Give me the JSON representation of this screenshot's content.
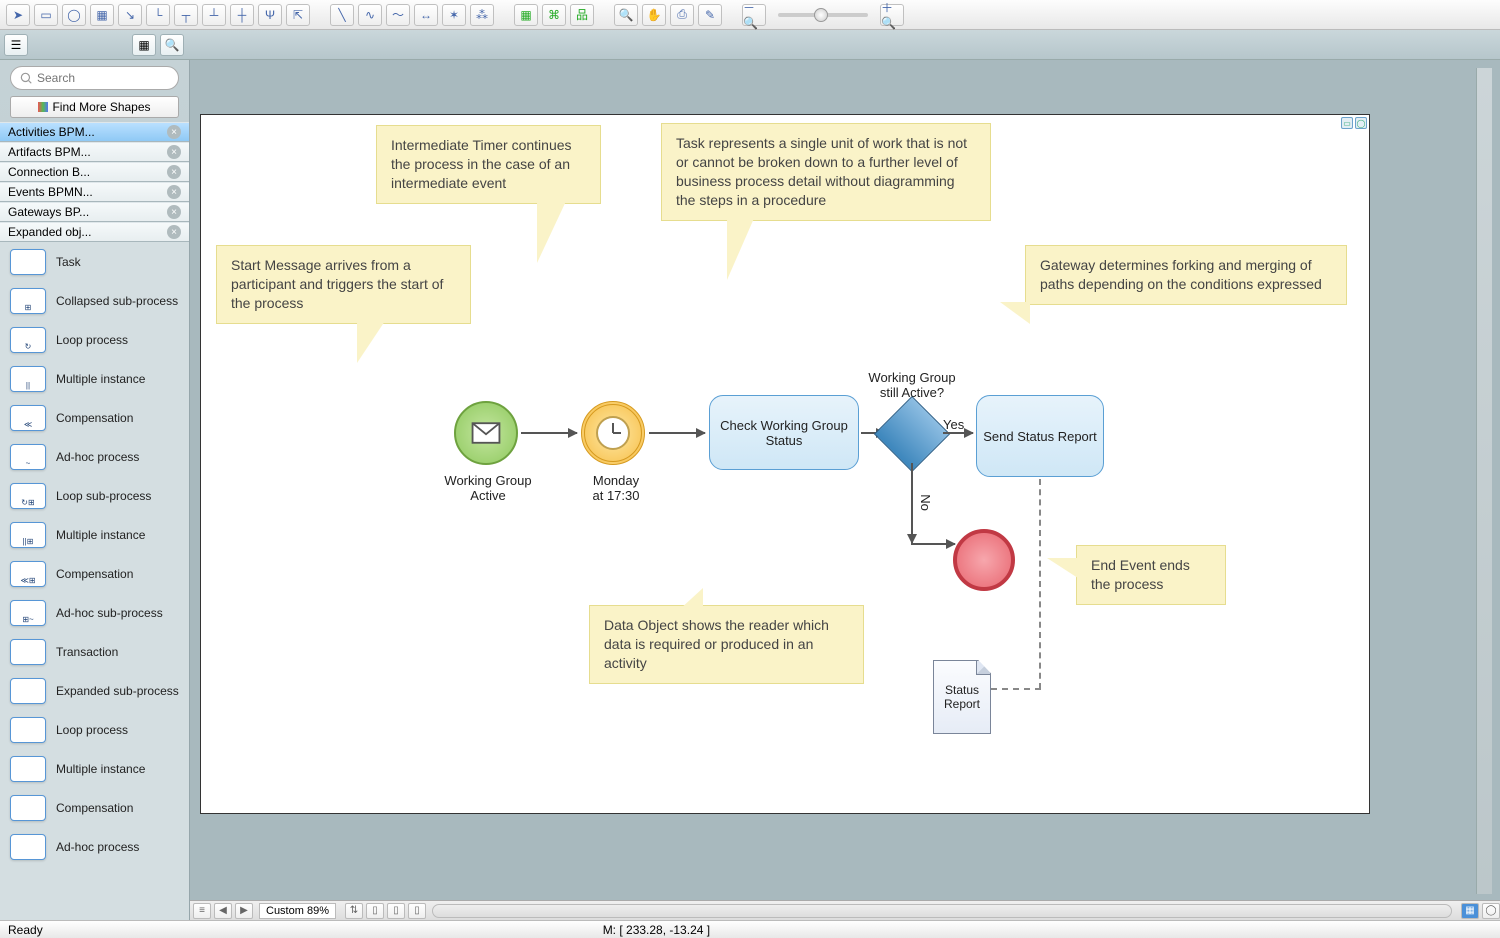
{
  "toolbar": {
    "icons": [
      "pointer",
      "rect",
      "ellipse",
      "table",
      "connector-straight",
      "connector-elbow",
      "connector-tree1",
      "connector-tree2",
      "connector-tree3",
      "connector-branch",
      "export",
      "line-diag",
      "line-curve",
      "line-s",
      "line-both",
      "line-star",
      "line-multi",
      "layout-grid",
      "layout-hier",
      "layout-org",
      "zoom-search",
      "pan-hand",
      "stamp",
      "eyedropper",
      "zoom-out",
      "zoom-in"
    ]
  },
  "sectoolbar": {
    "icons": [
      "tree-view",
      "spacer",
      "grid-view",
      "search-view"
    ]
  },
  "sidebar": {
    "search_placeholder": "Search",
    "find_more": "Find More Shapes",
    "categories": [
      {
        "label": "Activities BPM...",
        "selected": true
      },
      {
        "label": "Artifacts BPM...",
        "selected": false
      },
      {
        "label": "Connection B...",
        "selected": false
      },
      {
        "label": "Events BPMN...",
        "selected": false
      },
      {
        "label": "Gateways BP...",
        "selected": false
      },
      {
        "label": "Expanded obj...",
        "selected": false
      }
    ],
    "shapes": [
      {
        "label": "Task",
        "mark": ""
      },
      {
        "label": "Collapsed sub-process",
        "mark": "⊞"
      },
      {
        "label": "Loop process",
        "mark": "↻"
      },
      {
        "label": "Multiple instance",
        "mark": "||"
      },
      {
        "label": "Compensation",
        "mark": "≪"
      },
      {
        "label": "Ad-hoc process",
        "mark": "~"
      },
      {
        "label": "Loop sub-process",
        "mark": "↻⊞"
      },
      {
        "label": "Multiple instance",
        "mark": "||⊞"
      },
      {
        "label": "Compensation",
        "mark": "≪⊞"
      },
      {
        "label": "Ad-hoc sub-process",
        "mark": "⊞~"
      },
      {
        "label": "Transaction",
        "mark": ""
      },
      {
        "label": "Expanded sub-process",
        "mark": ""
      },
      {
        "label": "Loop process",
        "mark": ""
      },
      {
        "label": "Multiple instance",
        "mark": ""
      },
      {
        "label": "Compensation",
        "mark": ""
      },
      {
        "label": "Ad-hoc process",
        "mark": ""
      }
    ]
  },
  "diagram": {
    "annotations": {
      "a1": "Start Message arrives from a participant and triggers the start of the process",
      "a2": "Intermediate Timer continues the process in the case of an intermediate event",
      "a3": "Task represents a single unit of work that is not or cannot be broken down to a further level of business process detail without diagramming the steps in a procedure",
      "a4": "Gateway determines forking and merging of paths depending on the conditions expressed",
      "a5": "End Event ends the process",
      "a6": "Data Object shows the reader which data is required or produced in an activity"
    },
    "start_label": "Working Group\nActive",
    "timer_label": "Monday\nat 17:30",
    "task1": "Check Working Group Status",
    "task2": "Send Status Report",
    "gateway_label": "Working Group\nstill Active?",
    "yes": "Yes",
    "no": "No",
    "data_object": "Status\nReport"
  },
  "hbar": {
    "zoom": "Custom 89%"
  },
  "status": {
    "ready": "Ready",
    "mouse": "M: [ 233.28, -13.24 ]"
  }
}
